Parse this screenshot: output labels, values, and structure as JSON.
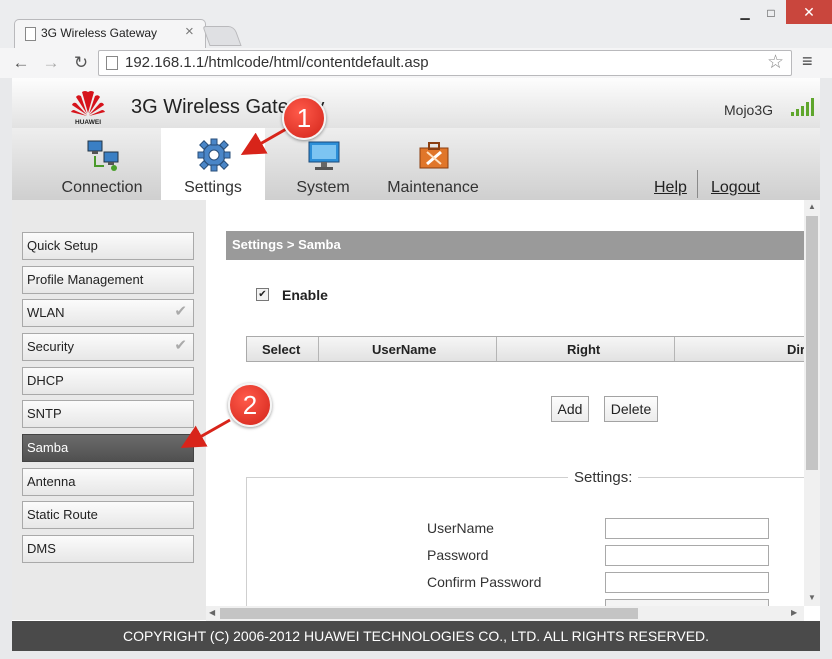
{
  "browser": {
    "tab_title": "3G Wireless Gateway",
    "url": "192.168.1.1/htmlcode/html/contentdefault.asp",
    "window_controls": [
      "minimize",
      "maximize",
      "close"
    ]
  },
  "header": {
    "logo_text": "HUAWEI",
    "title": "3G Wireless Gateway",
    "device_name": "Mojo3G",
    "signal_icon": "signal-bars-icon"
  },
  "nav": {
    "tabs": [
      {
        "label": "Connection",
        "icon": "network-computers-icon"
      },
      {
        "label": "Settings",
        "icon": "gear-icon",
        "active": true
      },
      {
        "label": "System",
        "icon": "monitor-icon"
      },
      {
        "label": "Maintenance",
        "icon": "toolbox-icon"
      }
    ],
    "help": "Help",
    "logout": "Logout"
  },
  "sidebar": {
    "items": [
      {
        "label": "Quick Setup"
      },
      {
        "label": "Profile Management"
      },
      {
        "label": "WLAN",
        "expandable": true
      },
      {
        "label": "Security",
        "expandable": true
      },
      {
        "label": "DHCP"
      },
      {
        "label": "SNTP"
      },
      {
        "label": "Samba",
        "active": true
      },
      {
        "label": "Antenna"
      },
      {
        "label": "Static Route"
      },
      {
        "label": "DMS"
      }
    ]
  },
  "content": {
    "breadcrumb": "Settings > Samba",
    "enable_label": "Enable",
    "enable_checked": true,
    "table_headers": [
      "Select",
      "UserName",
      "Right",
      "Dir"
    ],
    "add_button": "Add",
    "delete_button": "Delete",
    "settings_legend": "Settings:",
    "fields": [
      {
        "label": "UserName",
        "value": ""
      },
      {
        "label": "Password",
        "value": ""
      },
      {
        "label": "Confirm Password",
        "value": ""
      }
    ]
  },
  "annotations": {
    "callout_1": "1",
    "callout_2": "2"
  },
  "footer": "COPYRIGHT (C) 2006-2012 HUAWEI TECHNOLOGIES CO., LTD. ALL RIGHTS RESERVED.",
  "colors": {
    "callout_red": "#d2241a",
    "active_sidebar": "#5a5a5a",
    "content_header": "#9a9a9a",
    "footer_bg": "#4a4a4a"
  }
}
